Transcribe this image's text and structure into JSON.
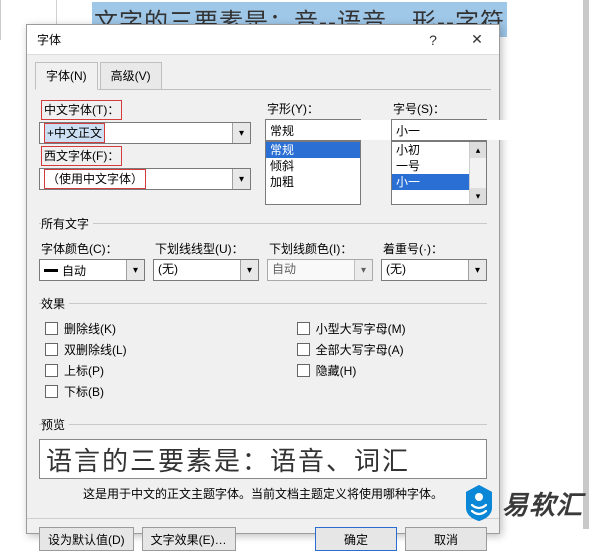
{
  "document": {
    "background_text": "文字的三要素是：音--语音、形--字符"
  },
  "dialog": {
    "title": "字体",
    "tabs": {
      "font": "字体(N)",
      "advanced": "高级(V)"
    },
    "fields": {
      "cn_font_label": "中文字体(T)：",
      "cn_font_value": "+中文正文",
      "west_font_label": "西文字体(F)：",
      "west_font_value": "（使用中文字体）",
      "style_label": "字形(Y)：",
      "style_value": "常规",
      "style_options": [
        "常规",
        "倾斜",
        "加粗"
      ],
      "size_label": "字号(S)：",
      "size_value": "小一",
      "size_options": [
        "小初",
        "一号",
        "小一"
      ]
    },
    "all_text": {
      "legend": "所有文字",
      "font_color_label": "字体颜色(C)：",
      "font_color_value": "自动",
      "underline_style_label": "下划线线型(U)：",
      "underline_style_value": "(无)",
      "underline_color_label": "下划线颜色(I)：",
      "underline_color_value": "自动",
      "emphasis_label": "着重号(·)：",
      "emphasis_value": "(无)"
    },
    "effects": {
      "legend": "效果",
      "strike": "删除线(K)",
      "dstrike": "双删除线(L)",
      "sup": "上标(P)",
      "sub": "下标(B)",
      "smallcaps": "小型大写字母(M)",
      "allcaps": "全部大写字母(A)",
      "hidden": "隐藏(H)"
    },
    "preview": {
      "legend": "预览",
      "text": "语言的三要素是：语音、词汇",
      "note": "这是用于中文的正文主题字体。当前文档主题定义将使用哪种字体。"
    },
    "buttons": {
      "default": "设为默认值(D)",
      "text_effects": "文字效果(E)…",
      "ok": "确定",
      "cancel": "取消"
    }
  },
  "watermark": {
    "brand": "易软汇"
  }
}
